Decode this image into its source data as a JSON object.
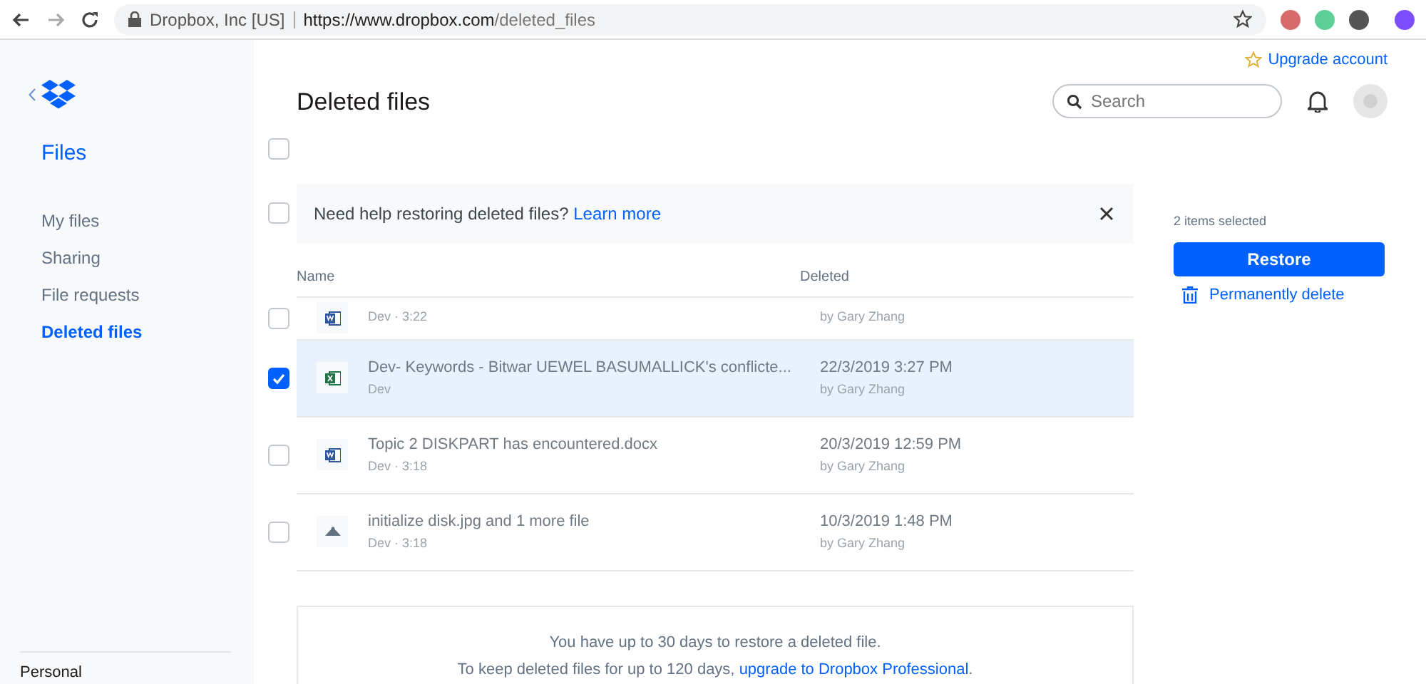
{
  "browser": {
    "site_identity": "Dropbox, Inc [US]",
    "url_host": "https://www.dropbox.com",
    "url_path": "/deleted_files"
  },
  "sidebar": {
    "section": "Files",
    "items": [
      {
        "label": "My files",
        "selected": false
      },
      {
        "label": "Sharing",
        "selected": false
      },
      {
        "label": "File requests",
        "selected": false
      },
      {
        "label": "Deleted files",
        "selected": true
      }
    ],
    "footer": "Personal"
  },
  "header": {
    "title": "Deleted files",
    "upgrade": "Upgrade account",
    "search": {
      "placeholder": "Search"
    }
  },
  "select_all": {
    "checked": false
  },
  "banner": {
    "checked": false,
    "text": "Need help restoring deleted files?",
    "link": "Learn more"
  },
  "table": {
    "columns": [
      "Name",
      "Deleted"
    ],
    "rows": [
      {
        "kind": "word",
        "name": null,
        "detail": "Dev · 3:22",
        "date": null,
        "by": "by Gary Zhang",
        "selected": false
      },
      {
        "kind": "excel",
        "name": "Dev- Keywords - Bitwar UEWEL BASUMALLICK's conflicte...",
        "detail": "Dev",
        "date": "22/3/2019 3:27 PM",
        "by": "by Gary Zhang",
        "selected": true
      },
      {
        "kind": "word",
        "name": "Topic 2 DISKPART has encountered.docx",
        "detail": "Dev · 3:18",
        "date": "20/3/2019 12:59 PM",
        "by": "by Gary Zhang",
        "selected": false
      },
      {
        "kind": "image",
        "name": "initialize disk.jpg and 1 more file",
        "detail": "Dev · 3:18",
        "date": "10/3/2019 1:48 PM",
        "by": "by Gary Zhang",
        "selected": false
      }
    ]
  },
  "selection": {
    "count": "2 items selected",
    "restore": "Restore",
    "delete": "Permanently delete"
  },
  "notice": {
    "line1": "You have up to 30 days to restore a deleted file.",
    "line2": "To keep deleted files for up to 120 days,",
    "link": "upgrade to Dropbox Professional",
    "end": "."
  }
}
